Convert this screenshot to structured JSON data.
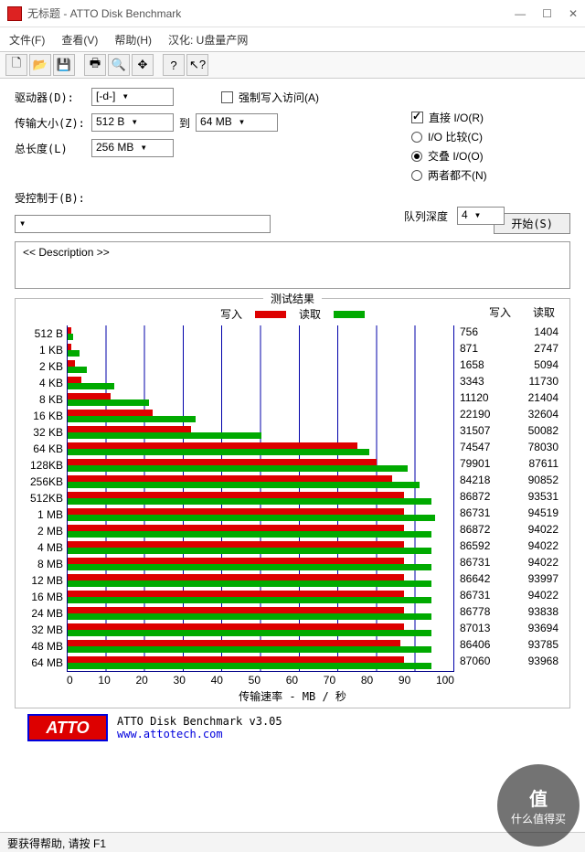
{
  "window": {
    "title": "无标题 - ATTO Disk Benchmark"
  },
  "menu": {
    "file": "文件(F)",
    "view": "查看(V)",
    "help": "帮助(H)",
    "han": "汉化: U盘量产网"
  },
  "labels": {
    "drive": "驱动器(D):",
    "xfer": "传输大小(Z):",
    "to": "到",
    "len": "总长度(L)",
    "ctrl": "受控制于(B):",
    "force": "强制写入访问(A)",
    "direct": "直接 I/O(R)",
    "iocmp": "I/O 比较(C)",
    "overlap": "交叠 I/O(O)",
    "neither": "两者都不(N)",
    "queue": "队列深度",
    "start": "开始(S)",
    "desc": "<< Description >>",
    "results": "测试结果",
    "write": "写入",
    "read": "读取",
    "xrate": "传输速率 - MB / 秒"
  },
  "vals": {
    "drive": "[-d-]",
    "min": "512 B",
    "max": "64 MB",
    "len": "256 MB",
    "queue": "4"
  },
  "footer": {
    "ver": "ATTO Disk Benchmark v3.05",
    "url": "www.attotech.com",
    "logo": "ATTO"
  },
  "status": "要获得帮助, 请按 F1",
  "watermark": "什么值得买",
  "chart_data": {
    "type": "bar",
    "xlabel": "传输速率 - MB / 秒",
    "xlim": [
      0,
      100
    ],
    "xticks": [
      0,
      10,
      20,
      30,
      40,
      50,
      60,
      70,
      80,
      90,
      100
    ],
    "series": [
      {
        "name": "写入",
        "color": "#d00"
      },
      {
        "name": "读取",
        "color": "#0a0"
      }
    ],
    "rows": [
      {
        "label": "512 B",
        "write": 756,
        "read": 1404,
        "wbar": 1,
        "rbar": 1.5
      },
      {
        "label": "1 KB",
        "write": 871,
        "read": 2747,
        "wbar": 1,
        "rbar": 3
      },
      {
        "label": "2 KB",
        "write": 1658,
        "read": 5094,
        "wbar": 2,
        "rbar": 5
      },
      {
        "label": "4 KB",
        "write": 3343,
        "read": 11730,
        "wbar": 3.5,
        "rbar": 12
      },
      {
        "label": "8 KB",
        "write": 11120,
        "read": 21404,
        "wbar": 11,
        "rbar": 21
      },
      {
        "label": "16 KB",
        "write": 22190,
        "read": 32604,
        "wbar": 22,
        "rbar": 33
      },
      {
        "label": "32 KB",
        "write": 31507,
        "read": 50082,
        "wbar": 32,
        "rbar": 50
      },
      {
        "label": "64 KB",
        "write": 74547,
        "read": 78030,
        "wbar": 75,
        "rbar": 78
      },
      {
        "label": "128KB",
        "write": 79901,
        "read": 87611,
        "wbar": 80,
        "rbar": 88
      },
      {
        "label": "256KB",
        "write": 84218,
        "read": 90852,
        "wbar": 84,
        "rbar": 91
      },
      {
        "label": "512KB",
        "write": 86872,
        "read": 93531,
        "wbar": 87,
        "rbar": 94
      },
      {
        "label": "1 MB",
        "write": 86731,
        "read": 94519,
        "wbar": 87,
        "rbar": 95
      },
      {
        "label": "2 MB",
        "write": 86872,
        "read": 94022,
        "wbar": 87,
        "rbar": 94
      },
      {
        "label": "4 MB",
        "write": 86592,
        "read": 94022,
        "wbar": 87,
        "rbar": 94
      },
      {
        "label": "8 MB",
        "write": 86731,
        "read": 94022,
        "wbar": 87,
        "rbar": 94
      },
      {
        "label": "12 MB",
        "write": 86642,
        "read": 93997,
        "wbar": 87,
        "rbar": 94
      },
      {
        "label": "16 MB",
        "write": 86731,
        "read": 94022,
        "wbar": 87,
        "rbar": 94
      },
      {
        "label": "24 MB",
        "write": 86778,
        "read": 93838,
        "wbar": 87,
        "rbar": 94
      },
      {
        "label": "32 MB",
        "write": 87013,
        "read": 93694,
        "wbar": 87,
        "rbar": 94
      },
      {
        "label": "48 MB",
        "write": 86406,
        "read": 93785,
        "wbar": 86,
        "rbar": 94
      },
      {
        "label": "64 MB",
        "write": 87060,
        "read": 93968,
        "wbar": 87,
        "rbar": 94
      }
    ]
  }
}
